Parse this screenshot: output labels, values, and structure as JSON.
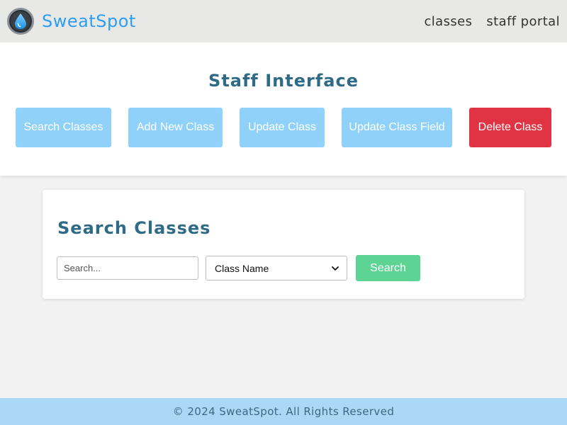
{
  "header": {
    "brand": "SweatSpot",
    "logo_icon": "water-drop-icon",
    "nav": [
      {
        "label": "classes"
      },
      {
        "label": "staff portal"
      }
    ]
  },
  "staff": {
    "title": "Staff Interface",
    "buttons": [
      {
        "label": "Search Classes",
        "color": "#8fd1f9"
      },
      {
        "label": "Add New Class",
        "color": "#8fd1f9"
      },
      {
        "label": "Update Class",
        "color": "#8fd1f9"
      },
      {
        "label": "Update Class Field",
        "color": "#8fd1f9"
      },
      {
        "label": "Delete Class",
        "color": "#e03445"
      }
    ]
  },
  "search": {
    "title": "Search Classes",
    "input_placeholder": "Search...",
    "input_value": "",
    "select_value": "Class Name",
    "button_label": "Search"
  },
  "footer": {
    "text": "© 2024 SweatSpot. All Rights Reserved"
  },
  "colors": {
    "brand": "#2e9ef0",
    "heading": "#2f6b86",
    "primary_button": "#8fd1f9",
    "danger_button": "#e03445",
    "search_button": "#5ed494",
    "footer_bg": "#abd8f5"
  }
}
